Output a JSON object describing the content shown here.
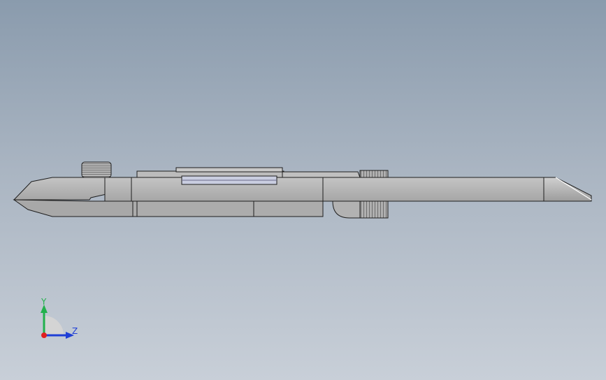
{
  "triad": {
    "y_label": "Y",
    "z_label": "Z",
    "colors": {
      "y": "#22b14c",
      "z": "#1f3fd6",
      "x": "#e02020"
    },
    "icon": "view-orientation-triad"
  },
  "model": {
    "icon": "pen-tool-part-side-view",
    "fill_color": "#b4b4b4",
    "edge_color": "#1e1e1e"
  }
}
